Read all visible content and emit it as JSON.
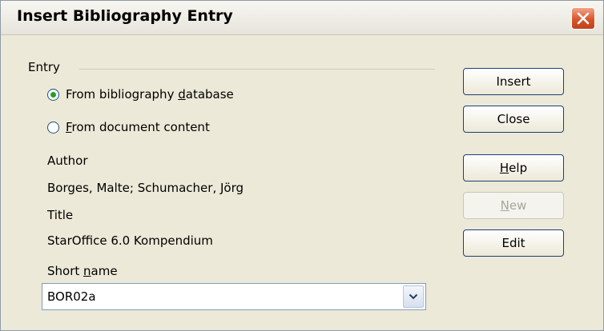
{
  "window": {
    "title": "Insert Bibliography Entry"
  },
  "entry": {
    "section_label": "Entry",
    "options": [
      {
        "prefix": "From bibliography ",
        "mnemonic": "d",
        "suffix": "atabase",
        "selected": true
      },
      {
        "prefix": "",
        "mnemonic": "F",
        "suffix": "rom document content",
        "selected": false
      }
    ],
    "author_label": "Author",
    "author_value": "Borges, Malte; Schumacher, Jörg",
    "title_label": "Title",
    "title_value": "StarOffice 6.0 Kompendium",
    "short_name": {
      "prefix": "Short ",
      "mnemonic": "n",
      "suffix": "ame",
      "value": "BOR02a"
    }
  },
  "buttons": {
    "insert": "Insert",
    "close": "Close",
    "help": {
      "mnemonic": "H",
      "rest": "elp"
    },
    "new": {
      "mnemonic": "N",
      "rest": "ew",
      "enabled": false
    },
    "edit": "Edit"
  },
  "colors": {
    "radio_selected_dot": "#21a121",
    "close_button": "#d6552b"
  }
}
